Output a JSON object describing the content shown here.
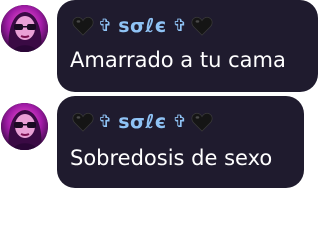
{
  "messages": [
    {
      "author": {
        "cross_left": "✞",
        "name": "ѕσℓє",
        "cross_right": "✞",
        "heart_icon": "black-heart",
        "avatar_icon": "profile-photo"
      },
      "text": "Amarrado a tu cama"
    },
    {
      "author": {
        "cross_left": "✞",
        "name": "ѕσℓє",
        "cross_right": "✞",
        "heart_icon": "black-heart",
        "avatar_icon": "profile-photo"
      },
      "text": "Sobredosis de sexo"
    }
  ],
  "colors": {
    "bubble": "#1f1b2e",
    "name": "#8fc3f5",
    "text": "#ffffff"
  }
}
